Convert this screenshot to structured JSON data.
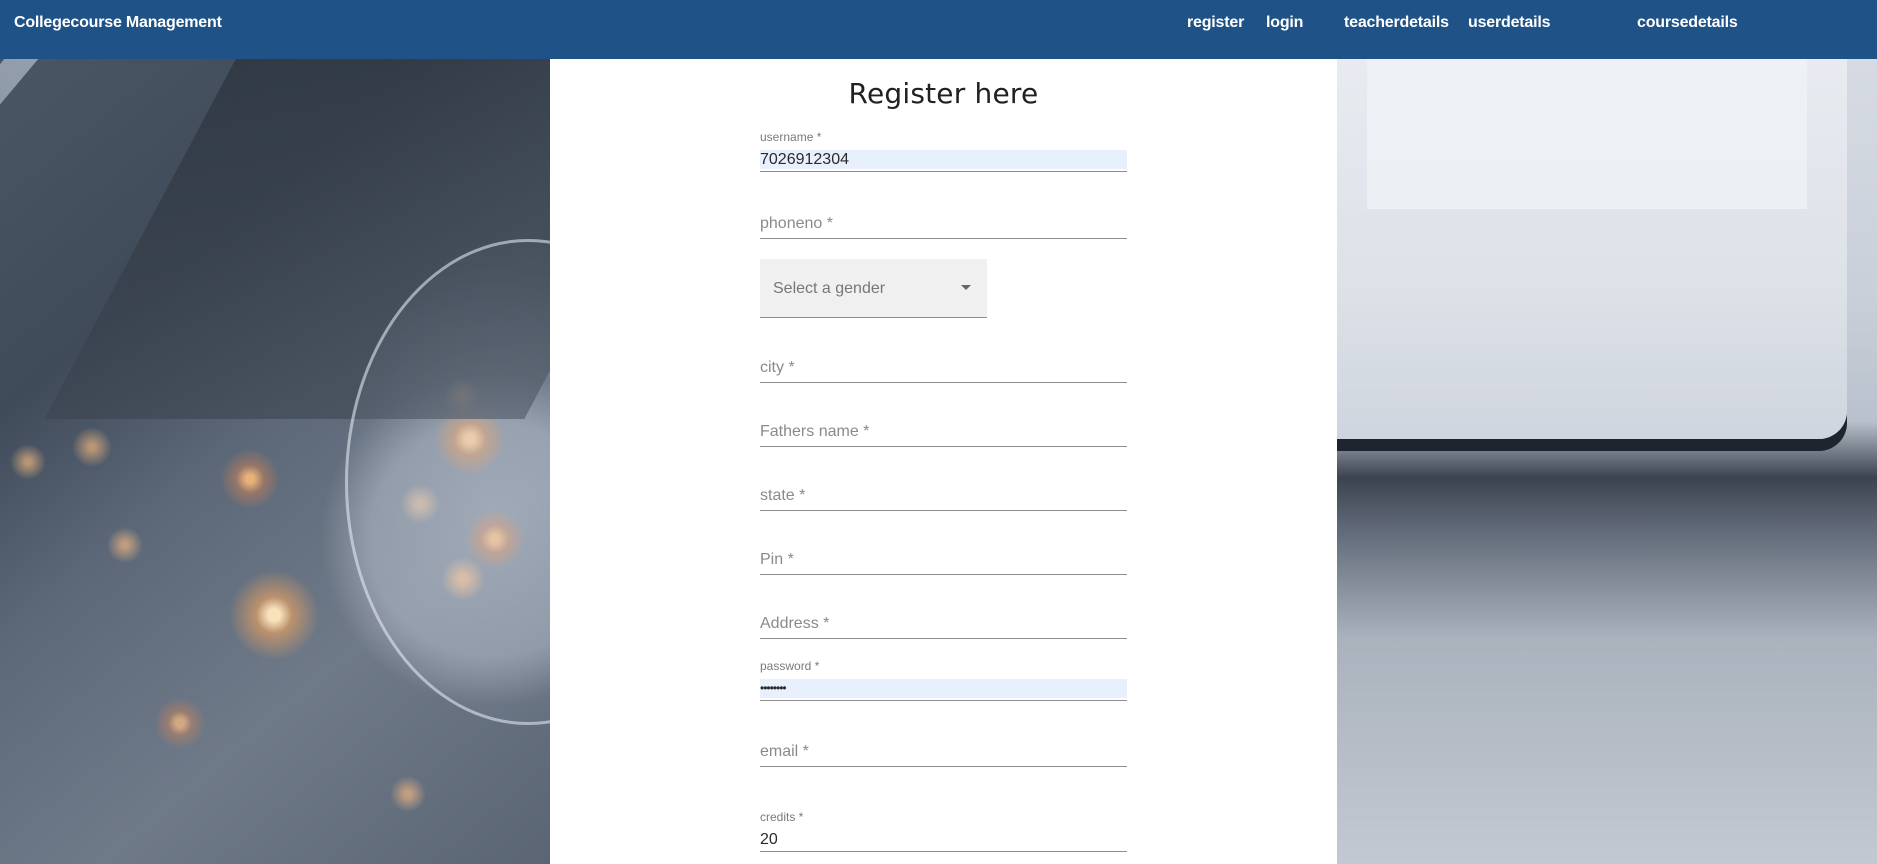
{
  "navbar": {
    "brand": "Collegecourse Management",
    "links": [
      "register",
      "login",
      "teacherdetails",
      "userdetails",
      "coursedetails"
    ]
  },
  "form": {
    "title": "Register here",
    "username": {
      "label": "username *",
      "value": "7026912304"
    },
    "phoneno": {
      "placeholder": "phoneno *"
    },
    "gender": {
      "placeholder": "Select a gender",
      "icon": "caret-down-icon"
    },
    "city": {
      "placeholder": "city *"
    },
    "fathers_name": {
      "placeholder": "Fathers name *"
    },
    "state": {
      "placeholder": "state *"
    },
    "pin": {
      "placeholder": "Pin *"
    },
    "address": {
      "placeholder": "Address *"
    },
    "password": {
      "label": "password *",
      "value": "••••••••"
    },
    "email": {
      "placeholder": "email *"
    },
    "credits": {
      "label": "credits *",
      "value": "20"
    }
  },
  "colors": {
    "navbar": "#1f5286",
    "autofill": "#e8f0fe",
    "select_bg": "#f0f0f0"
  }
}
